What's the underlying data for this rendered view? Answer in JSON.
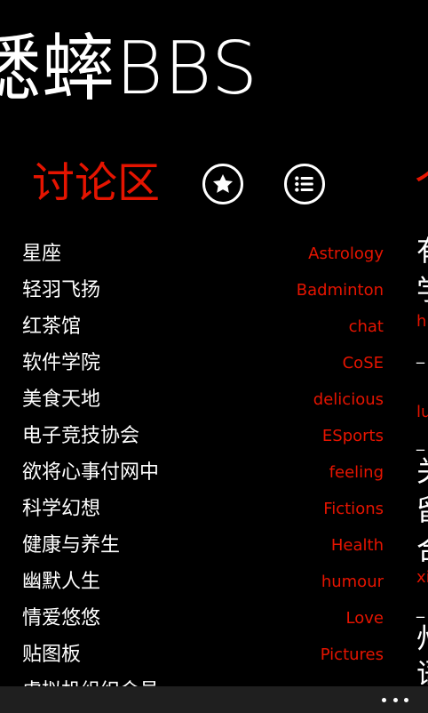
{
  "app": {
    "title": "蟋蟀BBS",
    "accent_color": "#e51400"
  },
  "section": {
    "title": "讨论区",
    "favorites_icon": "star-icon",
    "list_icon": "list-icon"
  },
  "forums": [
    {
      "cn": "星座",
      "en": "Astrology"
    },
    {
      "cn": "轻羽飞扬",
      "en": "Badminton"
    },
    {
      "cn": "红茶馆",
      "en": "chat"
    },
    {
      "cn": "软件学院",
      "en": "CoSE"
    },
    {
      "cn": "美食天地",
      "en": "delicious"
    },
    {
      "cn": "电子竞技协会",
      "en": "ESports"
    },
    {
      "cn": "欲将心事付网中",
      "en": "feeling"
    },
    {
      "cn": "科学幻想",
      "en": "Fictions"
    },
    {
      "cn": "健康与养生",
      "en": "Health"
    },
    {
      "cn": "幽默人生",
      "en": "humour"
    },
    {
      "cn": "情爱悠悠",
      "en": "Love"
    },
    {
      "cn": "贴图板",
      "en": "Pictures"
    },
    {
      "cn": "虚拟机组织会员",
      "en": ""
    }
  ],
  "next_pane": {
    "title_peek": "个",
    "lines": [
      "有",
      "学",
      "h",
      "_",
      "lu",
      "_",
      "关",
      "留",
      "合",
      "xi",
      "_",
      "州",
      "语"
    ]
  },
  "app_bar": {
    "more_icon": "ellipsis-icon"
  }
}
